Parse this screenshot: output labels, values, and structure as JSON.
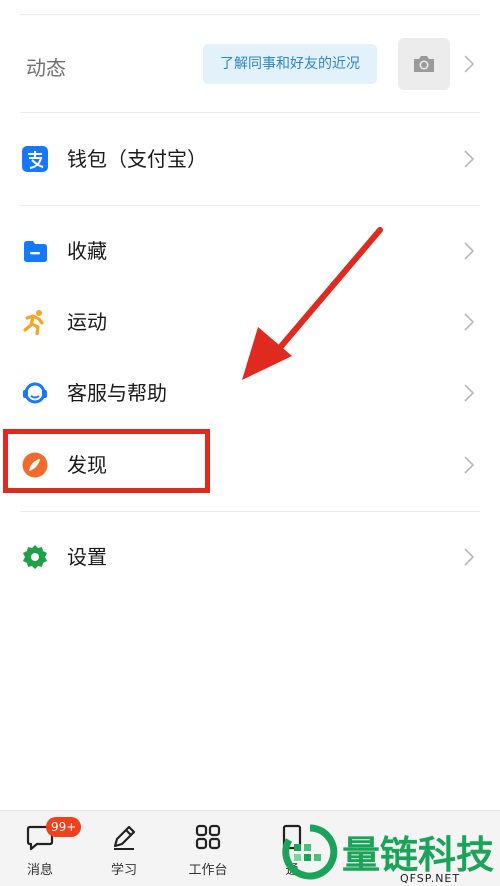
{
  "dynamic": {
    "label": "动态",
    "bubble_text": "了解同事和好友的近况",
    "camera_icon": "camera-icon"
  },
  "menu": {
    "wallet": "钱包（支付宝）",
    "favorites": "收藏",
    "sport": "运动",
    "support": "客服与帮助",
    "discover": "发现",
    "settings": "设置"
  },
  "tabs": {
    "messages": "消息",
    "messages_badge": "99+",
    "study": "学习",
    "workbench": "工作台",
    "contacts_partial": "通"
  },
  "watermark": {
    "text": "量链科技",
    "sub": "QFSP.NET"
  },
  "colors": {
    "accent_red": "#e02a20",
    "alipay_blue": "#1677ff",
    "sport_orange": "#f5a623",
    "discover_orange": "#f26b2c",
    "settings_green": "#21a04a",
    "watermark_green": "#1ca35a"
  }
}
